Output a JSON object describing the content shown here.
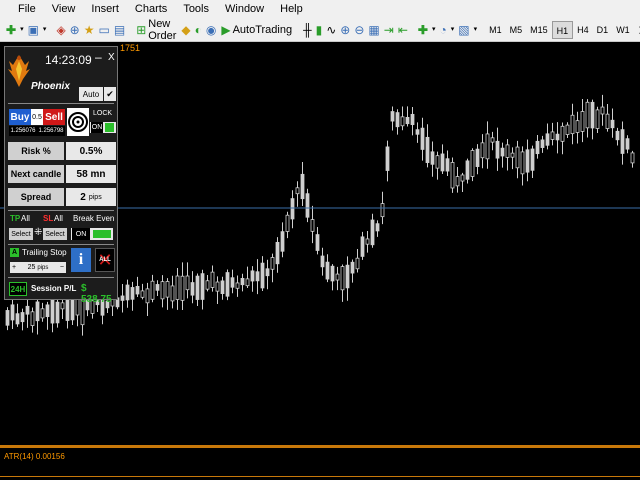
{
  "menu": [
    "File",
    "View",
    "Insert",
    "Charts",
    "Tools",
    "Window",
    "Help"
  ],
  "toolbar": {
    "new_order": "New Order",
    "auto_trading": "AutoTrading",
    "timeframes": [
      "M1",
      "M5",
      "M15",
      "H1",
      "H4",
      "D1",
      "W1"
    ],
    "active_timeframe": "H1"
  },
  "chart": {
    "price_top_label": "1751",
    "indicator_label": "ATR(14) 0.00156",
    "colors": {
      "candle": "#cfcfcf",
      "level_line": "#3a6ea8",
      "separator": "#c8780a"
    }
  },
  "panel": {
    "time": "14:23:09",
    "brand": "Phoenix",
    "close": "X",
    "mode": "Auto",
    "buy_label": "Buy",
    "sell_label": "Sell",
    "lot": "0.5",
    "buy_price": "1.256076",
    "sell_price": "1.256798",
    "lock_label": "LOCK",
    "lock_state": "ON",
    "risk_label": "Risk %",
    "risk_value": "0.5%",
    "next_candle_label": "Next candle",
    "next_candle_value": "58 mn",
    "spread_label": "Spread",
    "spread_value": "2",
    "spread_unit": "pips",
    "tp_label": "TP",
    "tp_all": "All",
    "sl_label": "SL",
    "sl_all": "All",
    "select_label": "Select",
    "break_even_label": "Break Even",
    "break_even_state": "ON",
    "trailing_stop_label": "Trailing Stop",
    "trailing_value": "25",
    "trailing_unit": "pips",
    "all_label": "ALL",
    "period": "24H",
    "session_label": "Session P/L",
    "session_value": "$ 538.75"
  }
}
